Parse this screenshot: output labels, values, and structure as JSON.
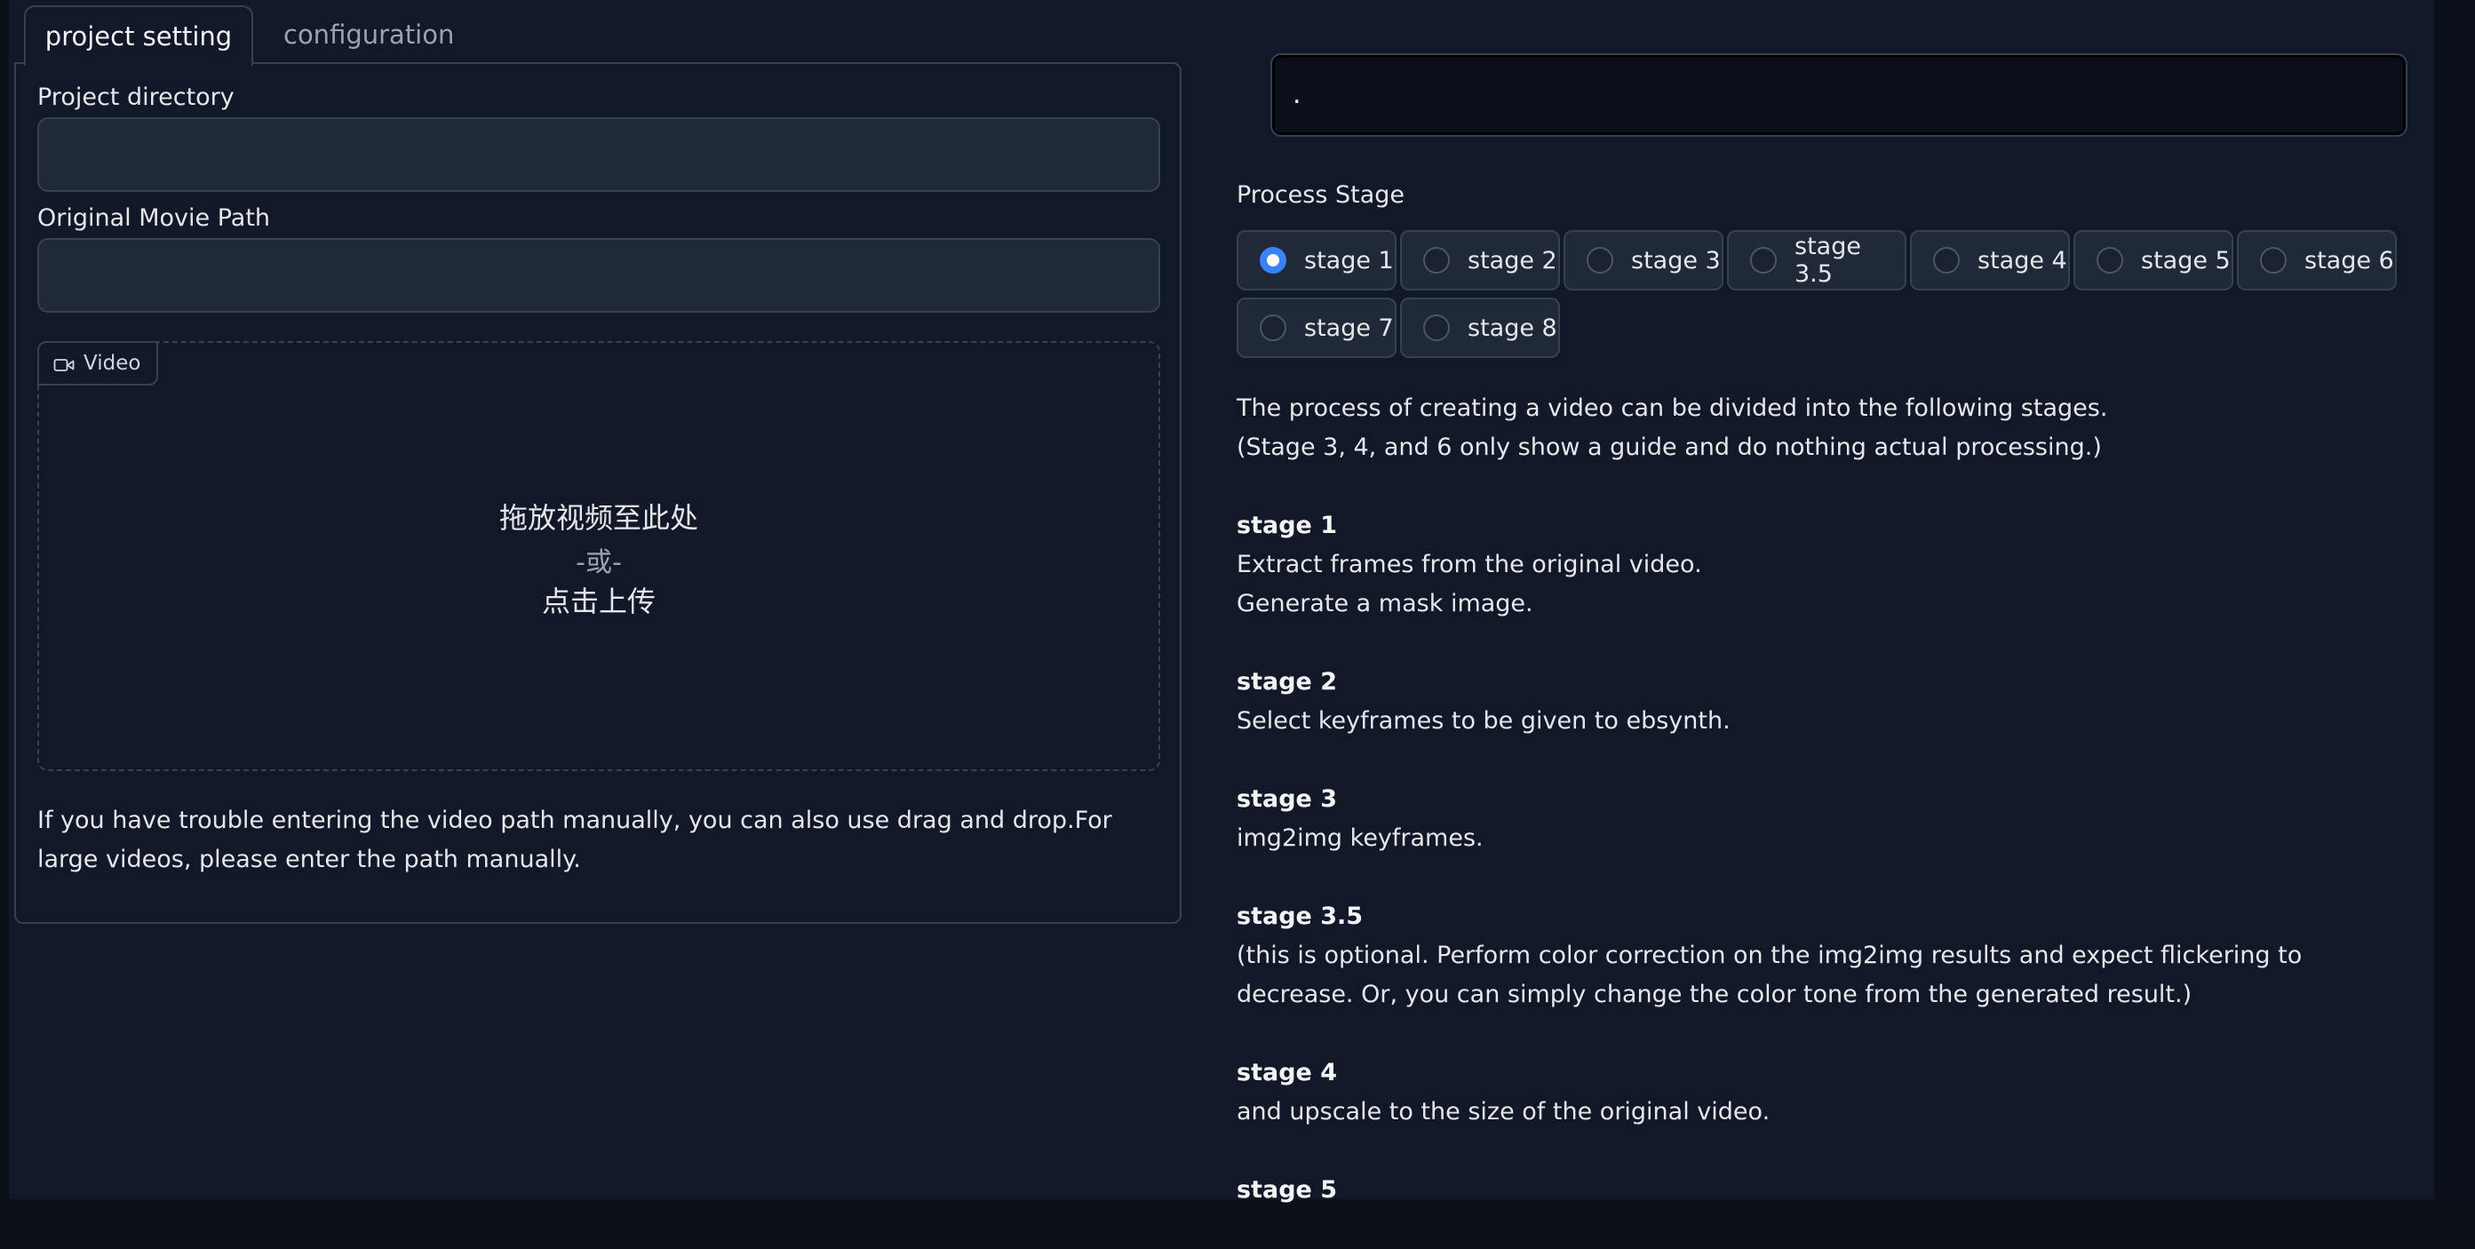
{
  "tabs": {
    "active": "project setting",
    "inactive": "configuration"
  },
  "project": {
    "directory_label": "Project directory",
    "directory_value": "",
    "movie_label": "Original Movie Path",
    "movie_value": ""
  },
  "video_upload": {
    "badge_label": "Video",
    "drop_main": "拖放视频至此处",
    "drop_or": "-或-",
    "drop_click": "点击上传"
  },
  "help_text": "If you have trouble entering the video path manually, you can also use drag and drop.For large videos, please enter the path manually.",
  "output_box": {
    "value": "."
  },
  "process_stage": {
    "label": "Process Stage",
    "selected": "stage 1",
    "options": [
      "stage 1",
      "stage 2",
      "stage 3",
      "stage 3.5",
      "stage 4",
      "stage 5",
      "stage 6",
      "stage 7",
      "stage 8"
    ]
  },
  "description": {
    "intro_line1": "The process of creating a video can be divided into the following stages.",
    "intro_line2": "(Stage 3, 4, and 6 only show a guide and do nothing actual processing.)",
    "stages": [
      {
        "title": "stage 1",
        "lines": [
          "Extract frames from the original video.",
          "Generate a mask image."
        ]
      },
      {
        "title": "stage 2",
        "lines": [
          "Select keyframes to be given to ebsynth."
        ]
      },
      {
        "title": "stage 3",
        "lines": [
          "img2img keyframes."
        ]
      },
      {
        "title": "stage 3.5",
        "lines": [
          "(this is optional. Perform color correction on the img2img results and expect flickering to decrease. Or, you can simply change the color tone from the generated result.)"
        ]
      },
      {
        "title": "stage 4",
        "lines": [
          "and upscale to the size of the original video."
        ]
      },
      {
        "title": "stage 5",
        "lines": []
      }
    ]
  },
  "colors": {
    "accent": "#3b82f6",
    "background": "#111827",
    "input_bg": "#1f2937",
    "border": "#374151"
  }
}
